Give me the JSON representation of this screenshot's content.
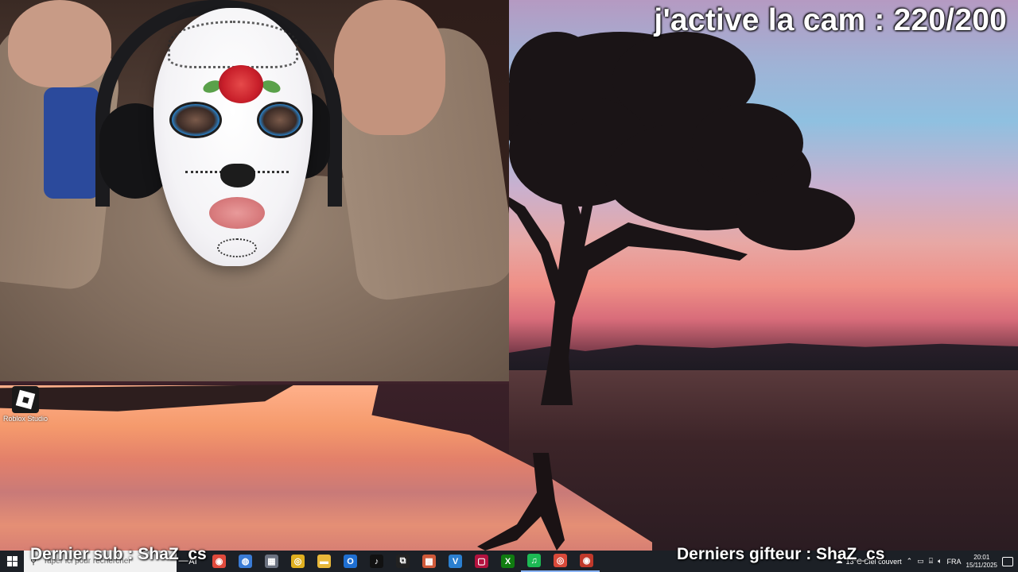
{
  "overlay": {
    "cam_goal": "j'active la cam : 220/200",
    "last_sub": "Dernier sub : ShaZ_cs",
    "last_gifter": "Derniers gifteur : ShaZ_cs"
  },
  "desktop": {
    "icons": [
      {
        "label": "Roblox Studio",
        "icon": "roblox-studio-icon"
      }
    ]
  },
  "taskbar": {
    "search_placeholder": "Taper ici pour rechercher",
    "text_app": "AI",
    "apps": [
      {
        "name": "app-red",
        "glyph": "◉",
        "color": "#e04a3c"
      },
      {
        "name": "app-blue-circle",
        "glyph": "◍",
        "color": "#3a7bd5"
      },
      {
        "name": "app-calculator",
        "glyph": "▦",
        "color": "#6b7280"
      },
      {
        "name": "chrome",
        "glyph": "◎",
        "color": "#e0b020"
      },
      {
        "name": "file-explorer",
        "glyph": "▬",
        "color": "#e8b83a"
      },
      {
        "name": "outlook",
        "glyph": "O",
        "color": "#1f6fd1"
      },
      {
        "name": "tiktok",
        "glyph": "♪",
        "color": "#111111"
      },
      {
        "name": "app-capcut",
        "glyph": "⧉",
        "color": "#222222"
      },
      {
        "name": "app-colorful",
        "glyph": "▩",
        "color": "#d05a3a"
      },
      {
        "name": "visual-studio",
        "glyph": "V",
        "color": "#2b7fd0"
      },
      {
        "name": "app-pink-square",
        "glyph": "▢",
        "color": "#b3123f"
      },
      {
        "name": "xbox",
        "glyph": "X",
        "color": "#107c10"
      },
      {
        "name": "spotify",
        "glyph": "♫",
        "color": "#1db954"
      },
      {
        "name": "chrome-2",
        "glyph": "◎",
        "color": "#d94a3a"
      },
      {
        "name": "app-red-2",
        "glyph": "◉",
        "color": "#c0392b"
      }
    ],
    "tray": {
      "weather": "13°C Ciel couvert",
      "language": "FRA",
      "time": "20:01",
      "date": "15/11/2025"
    }
  }
}
